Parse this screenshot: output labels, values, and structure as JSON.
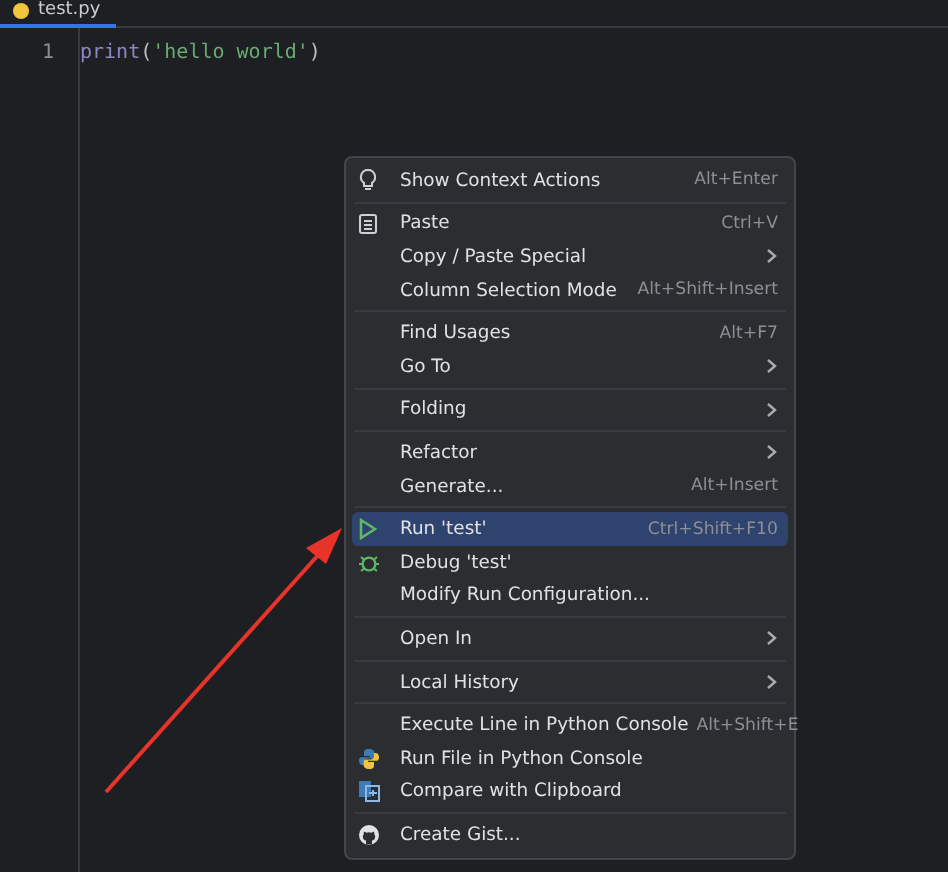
{
  "tab": {
    "title": "test.py"
  },
  "editor": {
    "line_number": "1",
    "code": [
      {
        "text": "print",
        "kind": "builtin"
      },
      {
        "text": "(",
        "kind": "paren"
      },
      {
        "text": "'hello world'",
        "kind": "string"
      },
      {
        "text": ")",
        "kind": "paren"
      }
    ]
  },
  "context_menu": {
    "groups": [
      [
        {
          "label": "Show Context Actions",
          "shortcut": "Alt+Enter",
          "submenu": false,
          "selected": false,
          "kind": "bulb"
        }
      ],
      [
        {
          "label": "Paste",
          "shortcut": "Ctrl+V",
          "submenu": false,
          "selected": false,
          "kind": "paste"
        },
        {
          "label": "Copy / Paste Special",
          "submenu": true,
          "selected": false,
          "kind": "plain"
        },
        {
          "label": "Column Selection Mode",
          "shortcut": "Alt+Shift+Insert",
          "submenu": false,
          "selected": false,
          "kind": "plain"
        }
      ],
      [
        {
          "label": "Find Usages",
          "shortcut": "Alt+F7",
          "submenu": false,
          "selected": false,
          "kind": "plain"
        },
        {
          "label": "Go To",
          "submenu": true,
          "selected": false,
          "kind": "plain"
        }
      ],
      [
        {
          "label": "Folding",
          "submenu": true,
          "selected": false,
          "kind": "plain"
        }
      ],
      [
        {
          "label": "Refactor",
          "submenu": true,
          "selected": false,
          "kind": "plain"
        },
        {
          "label": "Generate...",
          "shortcut": "Alt+Insert",
          "submenu": false,
          "selected": false,
          "kind": "plain"
        }
      ],
      [
        {
          "label": "Run 'test'",
          "shortcut": "Ctrl+Shift+F10",
          "submenu": false,
          "selected": true,
          "kind": "run"
        },
        {
          "label": "Debug 'test'",
          "submenu": false,
          "selected": false,
          "kind": "debug"
        },
        {
          "label": "Modify Run Configuration...",
          "submenu": false,
          "selected": false,
          "kind": "plain"
        }
      ],
      [
        {
          "label": "Open In",
          "submenu": true,
          "selected": false,
          "kind": "plain"
        }
      ],
      [
        {
          "label": "Local History",
          "submenu": true,
          "selected": false,
          "kind": "plain"
        }
      ],
      [
        {
          "label": "Execute Line in Python Console",
          "shortcut": "Alt+Shift+E",
          "submenu": false,
          "selected": false,
          "kind": "plain"
        },
        {
          "label": "Run File in Python Console",
          "submenu": false,
          "selected": false,
          "kind": "python"
        },
        {
          "label": "Compare with Clipboard",
          "submenu": false,
          "selected": false,
          "kind": "compare"
        }
      ],
      [
        {
          "label": "Create Gist...",
          "submenu": false,
          "selected": false,
          "kind": "github"
        }
      ]
    ]
  }
}
